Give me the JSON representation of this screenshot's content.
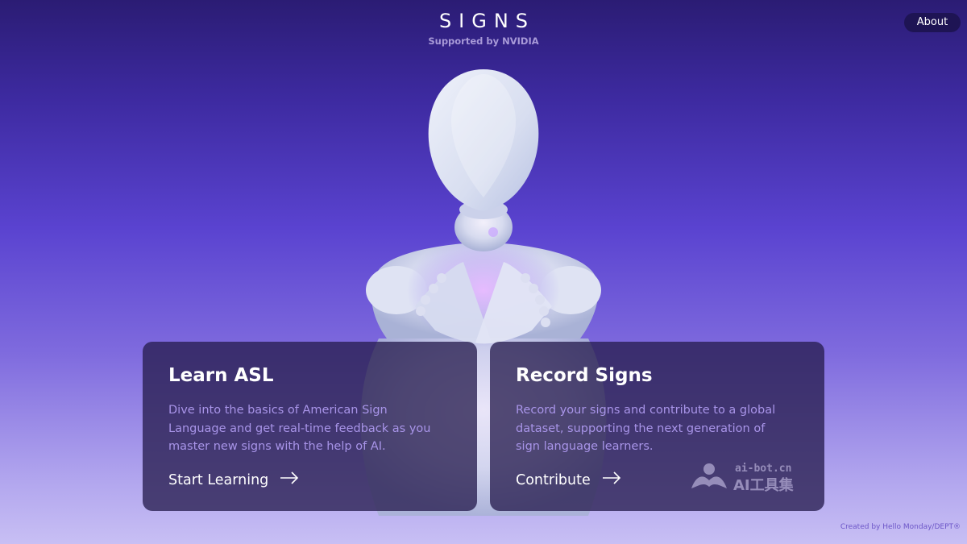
{
  "header": {
    "logo": "SIGNS",
    "subtitle": "Supported by NVIDIA",
    "about_label": "About"
  },
  "cards": [
    {
      "title": "Learn ASL",
      "description": "Dive into the basics of American Sign Language and get real-time feedback as you master new signs with the help of AI.",
      "cta": "Start Learning"
    },
    {
      "title": "Record Signs",
      "description": "Record your signs and contribute to a global dataset, supporting the next generation of sign language learners.",
      "cta": "Contribute"
    }
  ],
  "footer": {
    "credit": "Created by Hello Monday/DEPT®"
  },
  "watermark": {
    "domain": "ai-bot.cn",
    "label": "AI工具集"
  },
  "colors": {
    "accent": "#a894e8",
    "card_bg": "#281e50",
    "about_bg": "#1e1454"
  },
  "icons": {
    "cta_arrow": "arrow-right-icon",
    "watermark_logo": "ai-bot-logo-icon"
  }
}
